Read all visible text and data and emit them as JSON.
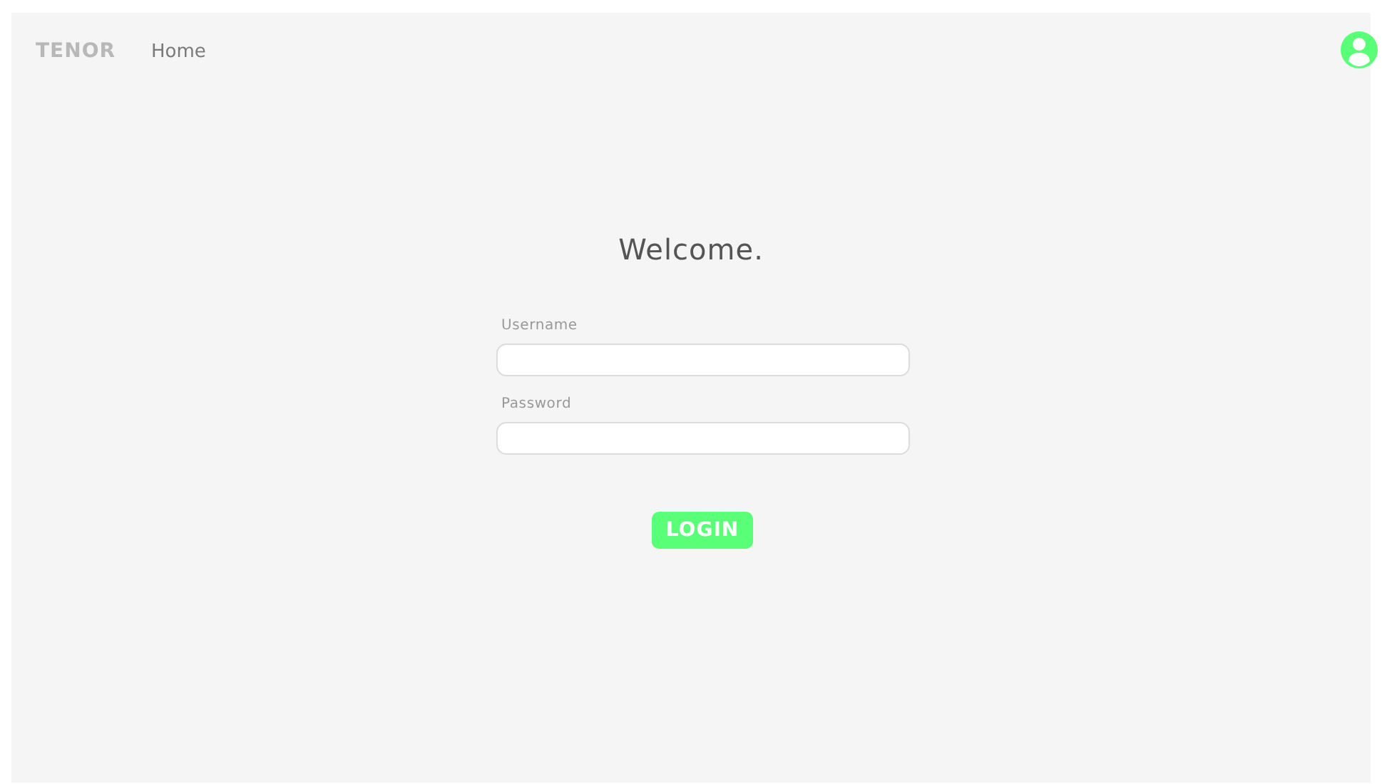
{
  "nav": {
    "brand": "TENOR",
    "links": [
      {
        "label": "Home"
      }
    ]
  },
  "heading": "Welcome.",
  "fields": [
    {
      "label": "Username"
    },
    {
      "label": "Password"
    }
  ],
  "button": "LOGIN"
}
